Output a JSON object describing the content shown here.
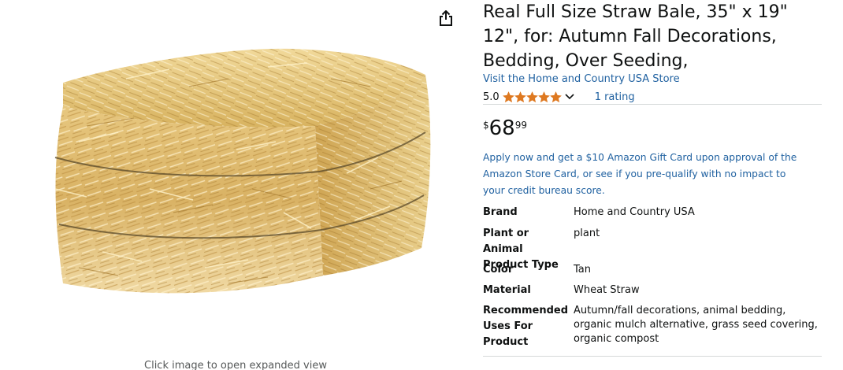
{
  "product": {
    "title": "Real Full Size Straw Bale, 35\" x 19\" 12\", for: Autumn Fall Decorations, Bedding, Over Seeding,",
    "store_link": "Visit the Home and Country USA Store",
    "rating_value": "5.0",
    "rating_stars": 5,
    "rating_count": "1 rating",
    "price_symbol": "$",
    "price_whole": "68",
    "price_fraction": "99",
    "apply_text": "Apply now and get a $10 Amazon Gift Card upon approval of the Amazon Store Card, or see if you pre-qualify with no impact to your credit bureau score."
  },
  "image": {
    "caption": "Click image to open expanded view",
    "share_icon": "share-icon"
  },
  "specs": [
    {
      "label": "Brand",
      "value": "Home and Country USA"
    },
    {
      "label": "Plant or Animal Product Type",
      "value": "plant"
    },
    {
      "label": "Color",
      "value": "Tan"
    },
    {
      "label": "Material",
      "value": "Wheat Straw"
    },
    {
      "label": "Recommended Uses For Product",
      "value": "Autumn/fall decorations, animal bedding, organic mulch alternative, grass seed covering, organic compost"
    }
  ],
  "colors": {
    "link": "#2162a1",
    "star": "#de7921",
    "text": "#0f1111",
    "muted": "#565959"
  }
}
